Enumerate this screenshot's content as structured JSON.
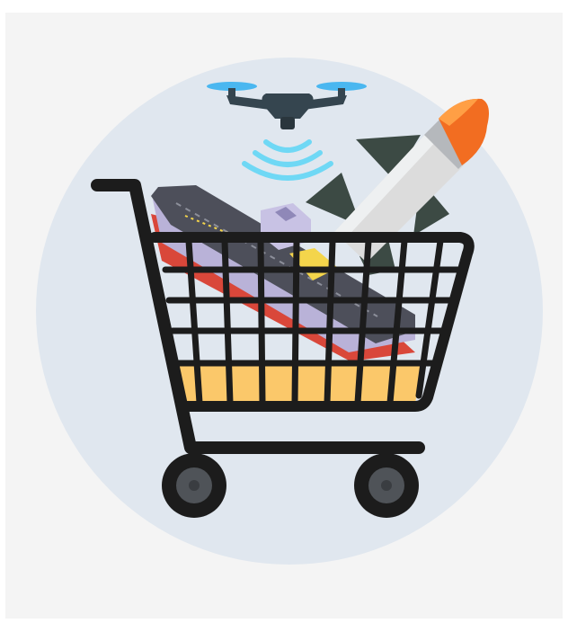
{
  "illustration": {
    "subject": "shopping-cart-with-military-hardware",
    "icons": [
      "drone-icon",
      "signal-waves-icon",
      "missile-icon",
      "aircraft-carrier-icon",
      "shopping-cart-icon"
    ],
    "colors": {
      "panel": "#f4f4f4",
      "circle": "#e0e7ef",
      "cart": "#1c1c1c",
      "cart_fill": "#fbc86a",
      "wheel_hub": "#4f5358",
      "drone": "#35454f",
      "drone_props": "#4ab7f0",
      "signal": "#6fd8f5",
      "missile_body": "#dcdcdc",
      "missile_tip": "#f26d21",
      "missile_fins": "#3c4a44",
      "ship_deck": "#4d4f5a",
      "ship_hull": "#b9b2d8",
      "ship_keel": "#d9473a",
      "ship_tower": "#f4d54b"
    }
  }
}
